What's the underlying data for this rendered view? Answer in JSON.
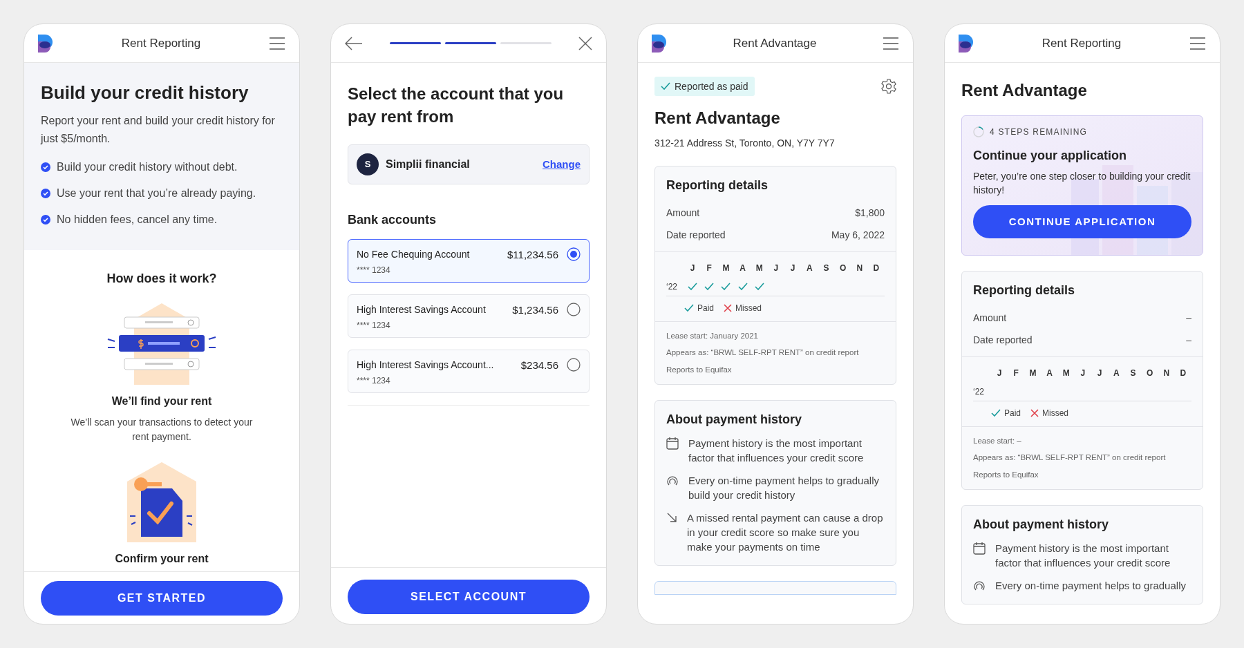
{
  "screens": [
    {
      "kind": "intro",
      "header": {
        "title": "Rent Reporting"
      },
      "heading": "Build your credit history",
      "intro": "Report your rent and build your credit history for just $5/month.",
      "benefits": [
        "Build your credit history without debt.",
        "Use your rent that you’re already paying.",
        "No hidden fees, cancel any time."
      ],
      "how_title": "How does it work?",
      "steps": [
        {
          "kind": "find",
          "title": "We’ll find your rent",
          "text": "We’ll scan your transactions to detect your rent payment."
        },
        {
          "kind": "confirm",
          "title": "Confirm your rent"
        }
      ],
      "button": "GET STARTED"
    },
    {
      "kind": "select_account",
      "progress": [
        {
          "done": true
        },
        {
          "done": true
        },
        {
          "done": false
        }
      ],
      "heading": "Select the account that you pay rent from",
      "institution": {
        "initial": "S",
        "name": "Simplii financial",
        "action": "Change"
      },
      "section_title": "Bank accounts",
      "accounts": [
        {
          "name": "No Fee Chequing Account",
          "mask": "**** 1234",
          "balance": "$11,234.56",
          "selected": true
        },
        {
          "name": "High Interest Savings Account",
          "mask": "**** 1234",
          "balance": "$1,234.56",
          "selected": false
        },
        {
          "name": "High Interest Savings Account...",
          "mask": "**** 1234",
          "balance": "$234.56",
          "selected": false
        }
      ],
      "button": "SELECT ACCOUNT"
    },
    {
      "kind": "details",
      "header": {
        "title": "Rent Advantage"
      },
      "status_badge": "Reported as paid",
      "heading": "Rent Advantage",
      "address": "312-21 Address St, Toronto, ON, Y7Y 7Y7",
      "reporting": {
        "title": "Reporting details",
        "rows": [
          {
            "label": "Amount",
            "value": "$1,800"
          },
          {
            "label": "Date reported",
            "value": "May 6, 2022"
          }
        ],
        "year": "‘22",
        "months": [
          {
            "label": "J",
            "paid": true
          },
          {
            "label": "F",
            "paid": true
          },
          {
            "label": "M",
            "paid": true
          },
          {
            "label": "A",
            "paid": true
          },
          {
            "label": "M",
            "paid": true
          },
          {
            "label": "J",
            "paid": false
          },
          {
            "label": "J",
            "paid": false
          },
          {
            "label": "A",
            "paid": false
          },
          {
            "label": "S",
            "paid": false
          },
          {
            "label": "O",
            "paid": false
          },
          {
            "label": "N",
            "paid": false
          },
          {
            "label": "D",
            "paid": false
          }
        ],
        "legend": {
          "paid": "Paid",
          "missed": "Missed"
        },
        "notes": [
          "Lease start: January 2021",
          "Appears as: “BRWL SELF-RPT RENT” on credit report",
          "Reports to Equifax"
        ]
      },
      "about": {
        "title": "About payment history",
        "items": [
          {
            "kind": "calendar",
            "text": "Payment history is the most important factor that influences your credit score"
          },
          {
            "kind": "gauge",
            "text": "Every on-time payment helps to gradually build your credit history"
          },
          {
            "kind": "arrow",
            "text": "A missed rental payment can cause a drop in your credit score so make sure you make your payments on time"
          }
        ]
      }
    },
    {
      "kind": "dashboard",
      "header": {
        "title": "Rent Reporting"
      },
      "heading": "Rent Advantage",
      "promo": {
        "steps": "4 STEPS REMAINING",
        "title": "Continue your application",
        "text": "Peter, you’re one step closer to building your credit history!",
        "button": "CONTINUE APPLICATION"
      },
      "reporting": {
        "title": "Reporting details",
        "rows": [
          {
            "label": "Amount",
            "value": "–"
          },
          {
            "label": "Date reported",
            "value": "–"
          }
        ],
        "year": "‘22",
        "months": [
          {
            "label": "J",
            "paid": false
          },
          {
            "label": "F",
            "paid": false
          },
          {
            "label": "M",
            "paid": false
          },
          {
            "label": "A",
            "paid": false
          },
          {
            "label": "M",
            "paid": false
          },
          {
            "label": "J",
            "paid": false
          },
          {
            "label": "J",
            "paid": false
          },
          {
            "label": "A",
            "paid": false
          },
          {
            "label": "S",
            "paid": false
          },
          {
            "label": "O",
            "paid": false
          },
          {
            "label": "N",
            "paid": false
          },
          {
            "label": "D",
            "paid": false
          }
        ],
        "legend": {
          "paid": "Paid",
          "missed": "Missed"
        },
        "notes": [
          "Lease start: –",
          "Appears as: “BRWL SELF-RPT RENT” on credit report",
          "Reports to Equifax"
        ]
      },
      "about": {
        "title": "About payment history",
        "items": [
          {
            "kind": "calendar",
            "text": "Payment history is the most important factor that influences your credit score"
          },
          {
            "kind": "gauge",
            "text": "Every on-time payment helps to gradually"
          }
        ]
      }
    }
  ]
}
